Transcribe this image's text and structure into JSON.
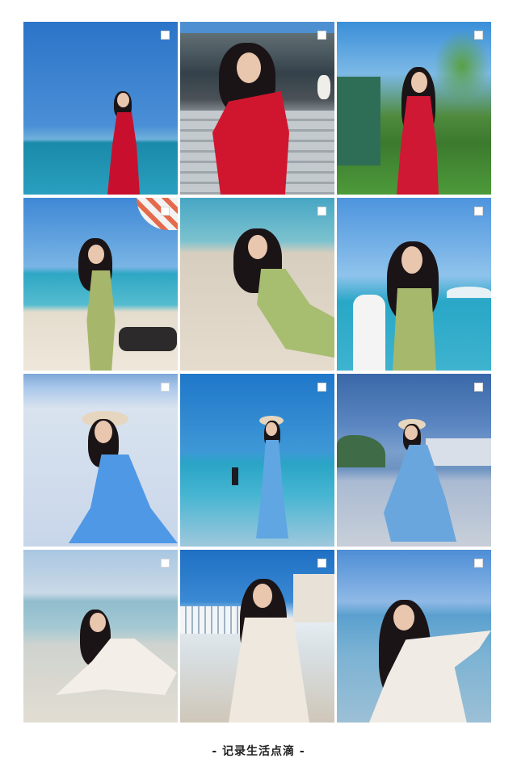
{
  "caption": "- 记录生活点滴 -",
  "photos": [
    {
      "id": "photo-1",
      "checkbox": "unchecked",
      "icon": "checkbox-icon"
    },
    {
      "id": "photo-2",
      "checkbox": "unchecked",
      "icon": "checkbox-icon"
    },
    {
      "id": "photo-3",
      "checkbox": "unchecked",
      "icon": "checkbox-icon"
    },
    {
      "id": "photo-4",
      "checkbox": "unchecked",
      "icon": "checkbox-icon"
    },
    {
      "id": "photo-5",
      "checkbox": "unchecked",
      "icon": "checkbox-icon"
    },
    {
      "id": "photo-6",
      "checkbox": "unchecked",
      "icon": "checkbox-icon"
    },
    {
      "id": "photo-7",
      "checkbox": "unchecked",
      "icon": "checkbox-icon"
    },
    {
      "id": "photo-8",
      "checkbox": "unchecked",
      "icon": "checkbox-icon"
    },
    {
      "id": "photo-9",
      "checkbox": "unchecked",
      "icon": "checkbox-icon"
    },
    {
      "id": "photo-10",
      "checkbox": "unchecked",
      "icon": "checkbox-icon"
    },
    {
      "id": "photo-11",
      "checkbox": "unchecked",
      "icon": "checkbox-icon"
    },
    {
      "id": "photo-12",
      "checkbox": "unchecked",
      "icon": "checkbox-icon"
    }
  ],
  "colors": {
    "background": "#ffffff",
    "caption_text": "#222222",
    "red_dress": "#c8102e",
    "green_dress": "#a6b76b",
    "blue_dress": "#5aa3e0",
    "white_outfit": "#f2ece4",
    "sky": "#2f7fd0",
    "sea": "#1e8fb8",
    "sand": "#e9e0d3"
  }
}
